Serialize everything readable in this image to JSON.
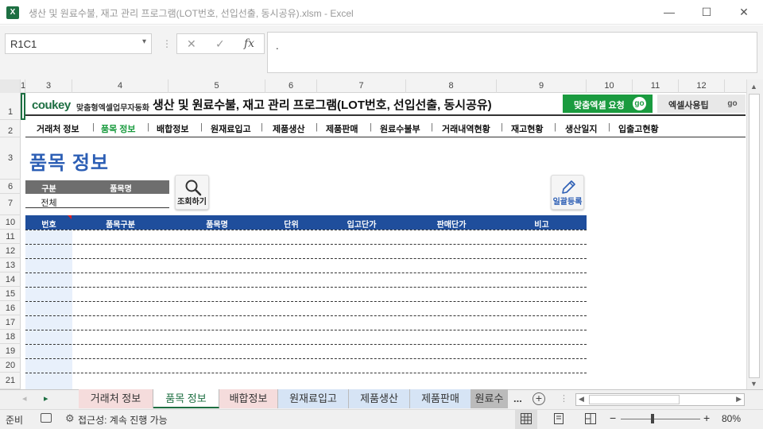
{
  "window": {
    "title": "생산 및 원료수불, 재고 관리 프로그램(LOT번호, 선입선출, 동시공유).xlsm - Excel",
    "app_icon_letter": "X",
    "minimize": "—",
    "maximize": "☐",
    "close": "✕"
  },
  "formula_bar": {
    "name_box": "R1C1",
    "cancel": "✕",
    "enter": "✓",
    "fx": "fx",
    "content": "."
  },
  "columns": [
    "1",
    "3",
    "4",
    "5",
    "6",
    "7",
    "8",
    "9",
    "10",
    "11",
    "12"
  ],
  "rows": [
    "1",
    "2",
    "3",
    "6",
    "7",
    "10",
    "11",
    "12",
    "13",
    "14",
    "15",
    "16",
    "17",
    "18",
    "19",
    "20",
    "21"
  ],
  "banner": {
    "logo_a": "cou",
    "logo_b": "key",
    "logo_sub": "맞춤형엑셀업무자동화",
    "title": "생산 및 원료수불, 재고 관리 프로그램(LOT번호, 선입선출, 동시공유)",
    "btn_custom": "맞춤엑셀 요청",
    "btn_tips": "엑셀사용팁",
    "go": "go"
  },
  "nav": {
    "items": [
      "거래처 정보",
      "품목 정보",
      "배합정보",
      "원재료입고",
      "제품생산",
      "제품판매",
      "원료수불부",
      "거래내역현황",
      "재고현황",
      "생산일지",
      "입출고현황"
    ],
    "separator": "|",
    "active_index": 1
  },
  "page_title": "품목 정보",
  "filter": {
    "col1": "구분",
    "col2": "품목명",
    "value1": "전체"
  },
  "buttons": {
    "search": "조회하기",
    "bulk": "일괄등록"
  },
  "table": {
    "headers": [
      "번호",
      "품목구분",
      "품목명",
      "단위",
      "입고단가",
      "판매단가",
      "비고"
    ]
  },
  "sheet_tabs": [
    {
      "label": "거래처 정보",
      "color": "#f5dcdc"
    },
    {
      "label": "품목 정보",
      "color": "#ffffff"
    },
    {
      "label": "배합정보",
      "color": "#f5dcdc"
    },
    {
      "label": "원재료입고",
      "color": "#d6e4f5"
    },
    {
      "label": "제품생산",
      "color": "#d6e4f5"
    },
    {
      "label": "제품판매",
      "color": "#d6e4f5"
    },
    {
      "label": "원료수",
      "color": "#bbbbbb"
    }
  ],
  "tab_nav": {
    "prev": "◂",
    "next": "▸",
    "more": "...",
    "add": "+"
  },
  "status": {
    "ready": "준비",
    "accessibility": "접근성: 계속 진행 가능",
    "zoom": "80%",
    "zoom_minus": "−",
    "zoom_plus": "+"
  }
}
